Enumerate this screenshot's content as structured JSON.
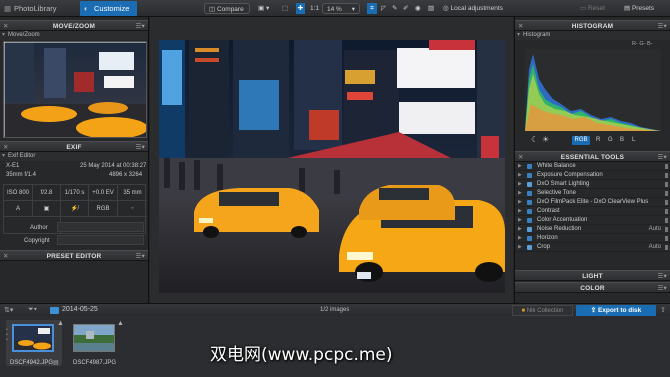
{
  "topbar": {
    "tabs": [
      {
        "label": "PhotoLibrary"
      },
      {
        "label": "Customize"
      }
    ],
    "compare_label": "Compare",
    "zoom_label": "1:1",
    "zoom_value": "14 %",
    "local_adjustments_label": "Local adjustments",
    "reset_label": "Reset",
    "presets_label": "Presets"
  },
  "left": {
    "movezoom": {
      "title": "MOVE/ZOOM",
      "sub": "Move/Zoom"
    },
    "exif": {
      "title": "EXIF",
      "sub": "Exif Editor",
      "camera": "X-E1",
      "date": "25 May 2014 at 00:38:27",
      "lens": "35mm f/1.4",
      "dims": "4896 x 3264",
      "iso": "ISO 800",
      "aperture": "f/2.8",
      "shutter": "1/170 s",
      "ev": "+0.0 EV",
      "focal": "35 mm",
      "mode": "A",
      "colorspace": "RGB",
      "author_label": "Author",
      "copyright_label": "Copyright"
    },
    "preset_editor": {
      "title": "PRESET EDITOR"
    }
  },
  "right": {
    "histogram": {
      "title": "HISTOGRAM",
      "sub": "Histogram",
      "readout": "R-  G-  B-",
      "channels": [
        "RGB",
        "R",
        "G",
        "B",
        "L"
      ]
    },
    "essential": {
      "title": "ESSENTIAL TOOLS",
      "items": [
        {
          "label": "White Balance",
          "value": ""
        },
        {
          "label": "Exposure Compensation",
          "value": ""
        },
        {
          "label": "DxO Smart Lighting",
          "value": ""
        },
        {
          "label": "Selective Tone",
          "value": ""
        },
        {
          "label": "DxO FilmPack Elite - DxO ClearView Plus",
          "value": ""
        },
        {
          "label": "Contrast",
          "value": ""
        },
        {
          "label": "Color Accentuation",
          "value": ""
        },
        {
          "label": "Noise Reduction",
          "value": "Auto"
        },
        {
          "label": "Horizon",
          "value": ""
        },
        {
          "label": "Crop",
          "value": "Auto"
        }
      ]
    },
    "light": {
      "title": "LIGHT"
    },
    "color": {
      "title": "COLOR"
    }
  },
  "filmbar": {
    "folder": "2014-05-25",
    "count": "1/2 images",
    "nik": "Nik Collection",
    "export": "Export to disk"
  },
  "film": {
    "items": [
      {
        "name": "DSCF4942.JPG"
      },
      {
        "name": "DSCF4987.JPG"
      }
    ]
  },
  "watermark": "双电网(www.pcpc.me)"
}
